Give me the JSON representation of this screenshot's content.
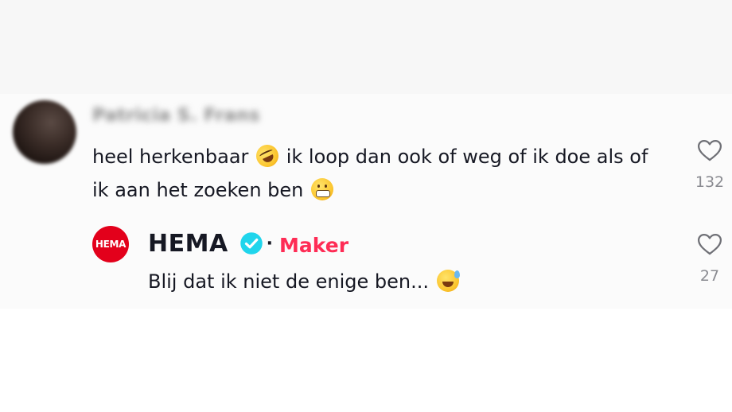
{
  "comment": {
    "author_name": "Patricia S. Frans",
    "text_part1": "heel herkenbaar",
    "text_part2": "ik loop dan ook of weg of ik doe als of ik aan het zoeken ben",
    "emoji_1": "rolling-on-floor-laughing-emoji",
    "emoji_2": "grimacing-face-emoji",
    "like_count": "132"
  },
  "reply": {
    "avatar_text": "HEMA",
    "author_name": "HEMA",
    "separator": "·",
    "badge_label": "Maker",
    "text": "Blij dat ik niet de enige ben...",
    "emoji": "grinning-face-with-sweat-emoji",
    "like_count": "27"
  },
  "colors": {
    "text_primary": "#161823",
    "text_secondary": "#8a8b91",
    "maker_badge": "#fe2c55",
    "verified_badge": "#20d5ec",
    "hema_red": "#e3001b"
  }
}
